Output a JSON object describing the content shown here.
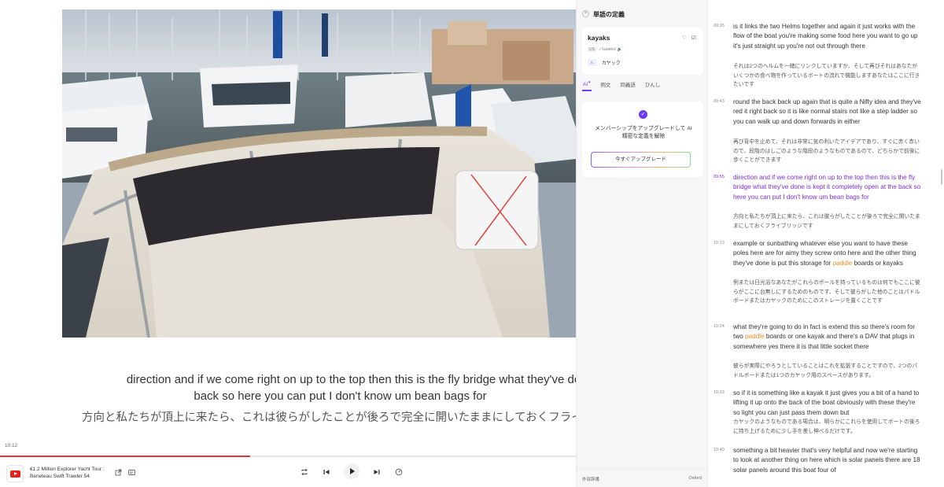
{
  "player": {
    "subtitle_en_line1": "direction and if we come right on up to the top then this is the fly bridge what they've done is kept it completely open at the",
    "subtitle_en_line2": "back so here you can put I don't know um bean bags for",
    "subtitle_ja": "方向と私たちが頂上に来たら、これは彼らがしたことが後ろで完全に開いたままにしておくフライブリッジです",
    "current_time": "10:12",
    "progress": 0.435,
    "video_title_line1": "€1.2 Million Explorer Yacht Tour :",
    "video_title_line2": "Beneteau Swift Trawler 54"
  },
  "dictionary": {
    "title": "単語の定義",
    "word": "kayaks",
    "region": "US",
    "phonetic": "/ˈkaɪæks/",
    "part_of_speech": "n.",
    "meaning": "カヤック",
    "tabs": [
      "AI",
      "例文",
      "同義語",
      "ひんし"
    ],
    "upsell_text": "メンバーシップをアップグレードして AI 精密な定義を解除",
    "upgrade_button": "今すぐアップグレード",
    "footer_left": "外部辞書",
    "footer_right": "Oxford"
  },
  "transcript": {
    "segments": [
      {
        "time": "09:35",
        "en": "is it links the two Helms together and again it just works with the flow of the boat you're making some food here you want to go up it's just straight up you're not out through there",
        "ja": "それは2つのヘルムを一緒にリンクしていますか、そして再びそれはあなたがいくつかの食べ物を作っているボートの流れで機能しますあなたはここに行きたいです"
      },
      {
        "time": "09:43",
        "en": "round the back back up again that is quite a Nifty idea and they've red it right back so it is like normal stairs not like a step ladder so you can walk up and down forwards in either",
        "ja": "再び背中を止めて、それは非常に気の利いたアイデアであり、すぐに赤く赤いので、段階のはしごのような階段のようなものであるので、どちらかで前後に歩くことができます"
      },
      {
        "time": "09:55",
        "en": "direction and if we come right on up to the top then this is the fly bridge what they've done is kept it completely open at the back so here you can put I don't know um bean bags for",
        "ja": "方向と私たちが頂上に来たら、これは彼らがしたことが後ろで完全に開いたままにしておくフライブリッジです"
      },
      {
        "time": "10:13",
        "en_before": "example or sunbathing whatever else you want to have these poles here are for aimy they screw onto here and the other thing they've done is put this storage for ",
        "en_highlight": "paddle",
        "en_after": " boards or kayaks",
        "ja": "例または日光浴なあなたがこれらのポールを持っているものは何でもここに彼らがここに台無しにするためのものです、そして彼らがした他のことはパドルボードまたはカヤックのためにこのストレージを置くことです"
      },
      {
        "time": "10:24",
        "en_before": "what they're going to do in fact is extend this so there's room for two ",
        "en_highlight": "paddle",
        "en_after": " boards or one kayak and there's a DAV that plugs in somewhere yes there it is that little socket there",
        "ja": "彼らが実際にやろうとしていることはこれを拡張することですので、2つのパドルボードまたは1つのカヤック用のスペースがあります。"
      },
      {
        "time": "10:33",
        "en": "so if it is something like a kayak it just gives you a bit of a hand to lifting it up onto the back of the boat obviously with these they're so light you can just pass them down but",
        "ja": "カヤックのようなものである場合は、明らかにこれらを使用してボートの後ろに持ち上げるために少し手を差し伸べるだけです。"
      },
      {
        "time": "10:40",
        "en": "something a bit heavier that's very helpful and now we're starting to look at another thing on here which is solar panels there are 18 solar panels around this boat four of",
        "ja": ""
      }
    ]
  }
}
